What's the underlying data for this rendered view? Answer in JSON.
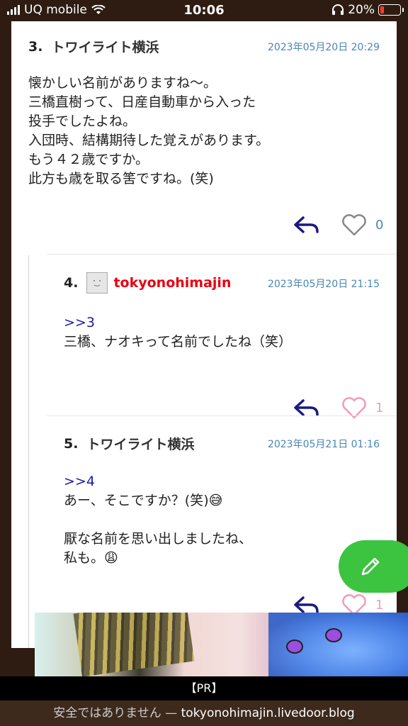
{
  "status_bar": {
    "carrier": "UQ mobile",
    "time": "10:06",
    "battery_percent": "20%"
  },
  "comments": [
    {
      "number": "3.",
      "author": "トワイライト横浜",
      "date": "2023年05月20日 20:29",
      "lines": [
        "懐かしい名前がありますね〜。",
        "三橋直樹って、日産自動車から入った",
        "投手でしたよね。",
        "入団時、結構期待した覚えがあります。",
        "もう４２歳ですか。",
        "此方も歳を取る筈ですね。(笑)"
      ],
      "like_count": "0"
    },
    {
      "number": "4.",
      "author": "tokyonohimajin",
      "date": "2023年05月20日 21:15",
      "anchor": ">>3",
      "lines": [
        "三橋、ナオキって名前でしたね（笑）"
      ],
      "like_count": "1"
    },
    {
      "number": "5.",
      "author": "トワイライト横浜",
      "date": "2023年05月21日 01:16",
      "anchor": ">>4",
      "lines": [
        "あー、そこですか？(笑)😅",
        "",
        "厭な名前を思い出しましたね、",
        "私も。😩"
      ],
      "like_count": "1"
    }
  ],
  "ad": {
    "label": "【PR】"
  },
  "url_bar": {
    "prefix": "安全ではありません — ",
    "url": "tokyonohimajin.livedoor.blog"
  },
  "colors": {
    "date_blue": "#4a86b4",
    "author_red": "#e60012",
    "heart_liked": "#f59ab5",
    "heart_empty": "#888888",
    "reply_navy": "#1a1a80",
    "fab_green": "#3cc33f"
  }
}
